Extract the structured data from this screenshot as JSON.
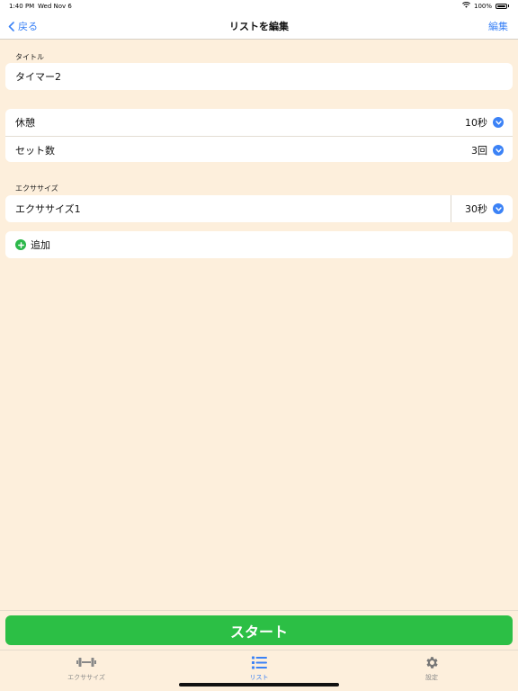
{
  "status_bar": {
    "time": "1:40 PM",
    "date": "Wed Nov 6",
    "battery": "100%"
  },
  "nav": {
    "back_label": "戻る",
    "title": "リストを編集",
    "edit_label": "編集"
  },
  "title_section": {
    "label": "タイトル",
    "value": "タイマー2"
  },
  "settings": [
    {
      "label": "休憩",
      "value": "10秒"
    },
    {
      "label": "セット数",
      "value": "3回"
    }
  ],
  "exercise_section": {
    "label": "エクササイズ",
    "items": [
      {
        "label": "エクササイズ1",
        "value": "30秒"
      }
    ],
    "add_label": "追加"
  },
  "start_label": "スタート",
  "tabs": [
    {
      "label": "エクササイズ",
      "icon": "dumbbell-icon",
      "active": false
    },
    {
      "label": "リスト",
      "icon": "list-icon",
      "active": true
    },
    {
      "label": "設定",
      "icon": "gear-icon",
      "active": false
    }
  ],
  "colors": {
    "background": "#fdefdc",
    "accent": "#3b82f6",
    "start": "#2cbf45"
  }
}
